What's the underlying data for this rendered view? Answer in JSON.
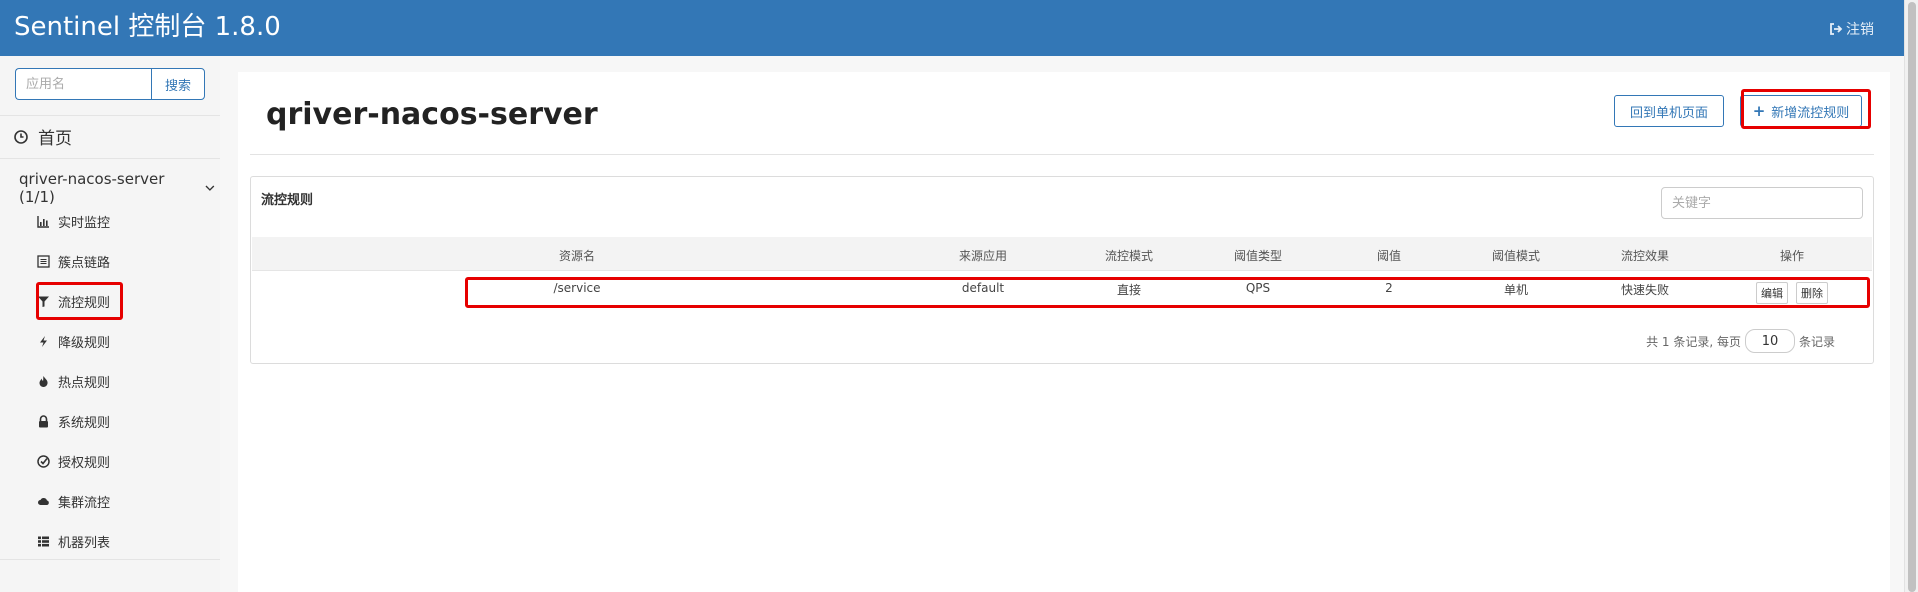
{
  "header": {
    "brand": "Sentinel 控制台 1.8.0",
    "logout_label": "注销",
    "bg_color": "#3377b6"
  },
  "sidebar": {
    "search_placeholder": "应用名",
    "search_button": "搜索",
    "home_label": "首页",
    "app_label": "qriver-nacos-server (1/1)",
    "items": [
      {
        "label": "实时监控",
        "icon": "bar-chart-icon"
      },
      {
        "label": "簇点链路",
        "icon": "list-icon"
      },
      {
        "label": "流控规则",
        "icon": "filter-icon"
      },
      {
        "label": "降级规则",
        "icon": "flash-icon"
      },
      {
        "label": "热点规则",
        "icon": "fire-icon"
      },
      {
        "label": "系统规则",
        "icon": "lock-icon"
      },
      {
        "label": "授权规则",
        "icon": "check-circle-icon"
      },
      {
        "label": "集群流控",
        "icon": "cloud-icon"
      },
      {
        "label": "机器列表",
        "icon": "grid-list-icon"
      }
    ]
  },
  "main": {
    "title": "qriver-nacos-server",
    "back_button": "回到单机页面",
    "add_button": "新增流控规则",
    "add_button_icon": "+",
    "panel_title": "流控规则",
    "filter_placeholder": "关键字",
    "table": {
      "headers": [
        "资源名",
        "来源应用",
        "流控模式",
        "阈值类型",
        "阈值",
        "阈值模式",
        "流控效果",
        "操作"
      ],
      "rows": [
        {
          "resource": "/service",
          "origin": "default",
          "mode": "直接",
          "grade": "QPS",
          "count": "2",
          "cluster_mode": "单机",
          "effect": "快速失败",
          "edit": "编辑",
          "delete": "删除"
        }
      ]
    },
    "pager": {
      "prefix": "共 1 条记录, 每页",
      "page_size": "10",
      "suffix": "条记录"
    }
  },
  "highlight_color": "#e60000"
}
